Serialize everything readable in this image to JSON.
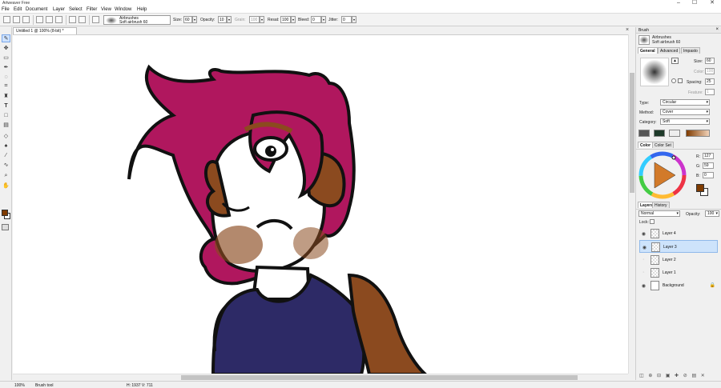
{
  "app": {
    "title": "Artweaver Free"
  },
  "window_controls": {
    "minimize": "–",
    "maximize": "☐",
    "close": "✕"
  },
  "menu": [
    "File",
    "Edit",
    "Document",
    "Layer",
    "Select",
    "Filter",
    "View",
    "Window",
    "Help"
  ],
  "toolbar": {
    "brush_category": "Airbrushes",
    "brush_name": "Soft airbrush 60",
    "size_label": "Size:",
    "size_value": "60",
    "opacity_label": "Opacity:",
    "opacity_value": "10",
    "grain_label": "Grain:",
    "grain_value": "100",
    "resat_label": "Resat:",
    "resat_value": "100",
    "bleed_label": "Bleed:",
    "bleed_value": "0",
    "jitter_label": "Jitter:",
    "jitter_value": "0"
  },
  "document": {
    "tab_title": "Untitled 1 @ 100% (8-bit) *",
    "close": "×"
  },
  "status": {
    "zoom": "100%",
    "tool": "Brush tool",
    "coords": "H: 1937 V: 711"
  },
  "tools": [
    {
      "icon": "brush-icon",
      "glyph": "✎"
    },
    {
      "icon": "move-icon",
      "glyph": "✥"
    },
    {
      "icon": "marquee-icon",
      "glyph": "▭"
    },
    {
      "icon": "pen-icon",
      "glyph": "✒"
    },
    {
      "icon": "lasso-icon",
      "glyph": "◌"
    },
    {
      "icon": "crop-icon",
      "glyph": "⌗"
    },
    {
      "icon": "stamp-icon",
      "glyph": "♜"
    },
    {
      "icon": "text-icon",
      "glyph": "T"
    },
    {
      "icon": "shape-icon",
      "glyph": "□"
    },
    {
      "icon": "gradient-icon",
      "glyph": "▤"
    },
    {
      "icon": "eraser-icon",
      "glyph": "◇"
    },
    {
      "icon": "fill-icon",
      "glyph": "♠"
    },
    {
      "icon": "eyedropper-icon",
      "glyph": "⁄"
    },
    {
      "icon": "smudge-icon",
      "glyph": "∿"
    },
    {
      "icon": "zoom-icon",
      "glyph": "⌕"
    },
    {
      "icon": "hand-icon",
      "glyph": "✋"
    }
  ],
  "colors": {
    "foreground": "#7f3b00",
    "background": "#ffffff",
    "hair": "#b0175e",
    "skin": "#8b4a1f",
    "shirt": "#2d2a66",
    "outline": "#111111",
    "accent": "#cde3fb"
  },
  "brush_panel": {
    "title": "Brush",
    "category": "Airbrushes",
    "name": "Soft airbrush 60",
    "tabs": [
      "General",
      "Advanced",
      "Impasto"
    ],
    "size_label": "Size:",
    "size_value": "60",
    "color_label": "Color:",
    "color_value": "100",
    "spacing_label": "Spacing:",
    "spacing_value": "25",
    "feature_label": "Feature:",
    "feature_value": "1",
    "type_label": "Type:",
    "type_value": "Circular",
    "method_label": "Method:",
    "method_value": "Cover",
    "category_label": "Category:",
    "category_value": "Soft"
  },
  "color_panel": {
    "tabs": [
      "Color",
      "Color Set"
    ],
    "r_label": "R:",
    "r_value": "127",
    "g_label": "G:",
    "g_value": "59",
    "b_label": "B:",
    "b_value": "0"
  },
  "layers_panel": {
    "tabs": [
      "Layers",
      "History"
    ],
    "blend_mode": "Normal",
    "opacity_label": "Opacity:",
    "opacity_value": "100",
    "lock_label": "Lock:",
    "layers": [
      {
        "name": "Layer 4",
        "visible": true,
        "selected": false
      },
      {
        "name": "Layer 3",
        "visible": true,
        "selected": true
      },
      {
        "name": "Layer 2",
        "visible": false,
        "selected": false
      },
      {
        "name": "Layer 1",
        "visible": false,
        "selected": false
      },
      {
        "name": "Background",
        "visible": true,
        "selected": false,
        "locked": true
      }
    ]
  }
}
